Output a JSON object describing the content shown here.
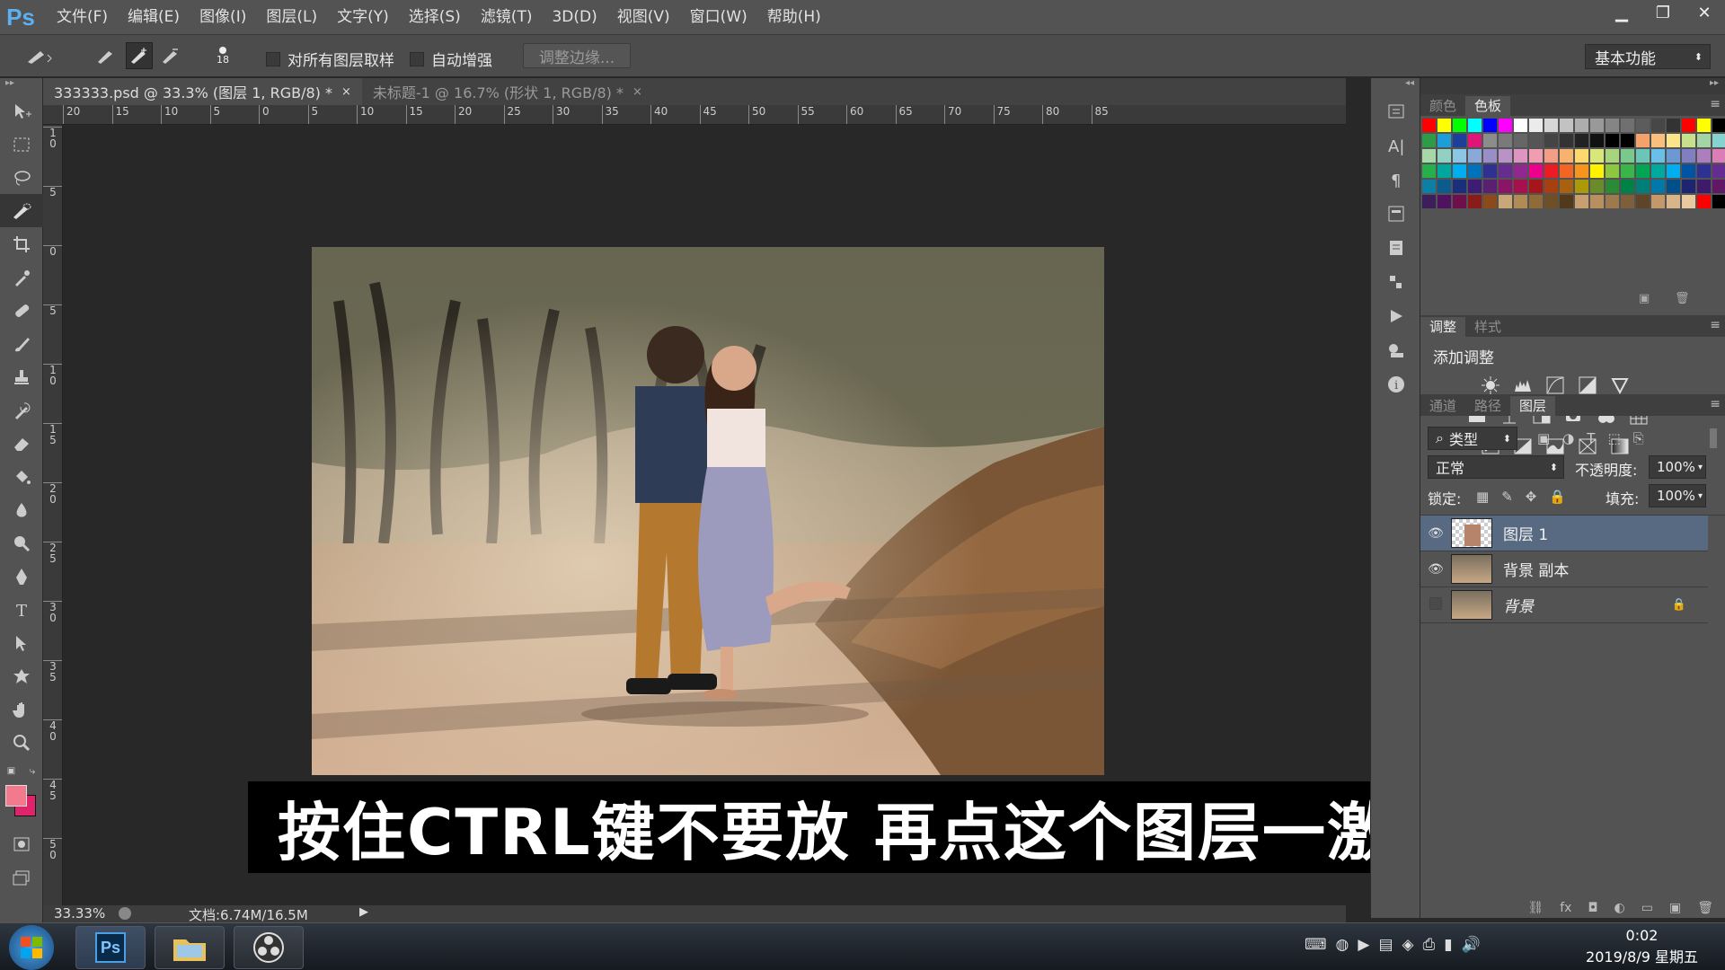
{
  "app": {
    "logo": "Ps"
  },
  "menu": [
    "文件(F)",
    "编辑(E)",
    "图像(I)",
    "图层(L)",
    "文字(Y)",
    "选择(S)",
    "滤镜(T)",
    "3D(D)",
    "视图(V)",
    "窗口(W)",
    "帮助(H)"
  ],
  "window_controls": {
    "minimize": "▁",
    "restore": "❐",
    "close": "✕"
  },
  "options": {
    "brush_size": "18",
    "sample_all_layers": "对所有图层取样",
    "auto_enhance": "自动增强",
    "refine_edge": "调整边缘...",
    "workspace": "基本功能"
  },
  "tabs": [
    {
      "label": "333333.psd @ 33.3% (图层 1, RGB/8) *",
      "close": "×"
    },
    {
      "label": "未标题-1 @ 16.7% (形状 1, RGB/8) *",
      "close": "×"
    }
  ],
  "ruler_h": [
    "20",
    "15",
    "10",
    "5",
    "0",
    "5",
    "10",
    "15",
    "20",
    "25",
    "30",
    "35",
    "40",
    "45",
    "50",
    "55",
    "60",
    "65",
    "70",
    "75",
    "80",
    "85"
  ],
  "ruler_v": [
    "1\n0",
    "5",
    "0",
    "5",
    "1\n0",
    "1\n5",
    "2\n0",
    "2\n5",
    "3\n0",
    "3\n5",
    "4\n0",
    "4\n5",
    "5\n0"
  ],
  "status": {
    "zoom": "33.33%",
    "doc": "文档:6.74M/16.5M"
  },
  "caption": "按住CTRL键不要放 再点这个图层一激活",
  "panels": {
    "color_tabs": [
      "颜色",
      "色板"
    ],
    "adjust_tabs": [
      "调整",
      "样式"
    ],
    "add_adjustment": "添加调整",
    "layer_tabs": [
      "通道",
      "路径",
      "图层"
    ],
    "filter_type": "类型",
    "blend_mode": "正常",
    "opacity_label": "不透明度:",
    "opacity_value": "100%",
    "lock_label": "锁定:",
    "fill_label": "填充:",
    "fill_value": "100%"
  },
  "layers": [
    {
      "name": "图层 1",
      "visible": true,
      "active": true
    },
    {
      "name": "背景 副本",
      "visible": true,
      "active": false
    },
    {
      "name": "背景",
      "visible": false,
      "active": false,
      "locked": true
    }
  ],
  "swatch_colors": [
    "#ff0000",
    "#ffff00",
    "#00ff00",
    "#00ffff",
    "#0000ff",
    "#ff00ff",
    "#ffffff",
    "#ebebeb",
    "#d6d6d6",
    "#c2c2c2",
    "#adadad",
    "#999999",
    "#858585",
    "#707070",
    "#5c5c5c",
    "#474747",
    "#333333",
    "#ff0000",
    "#ffff00",
    "#000000",
    "#2d9b48",
    "#1e9ed8",
    "#1d3f9a",
    "#e0157a",
    "#8c8c8c",
    "#7a7a7a",
    "#666666",
    "#555555",
    "#444444",
    "#333333",
    "#222222",
    "#111111",
    "#000000",
    "#000000",
    "#f5a26a",
    "#f9c07d",
    "#fbe48a",
    "#c6e08c",
    "#a2d4a5",
    "#86d2d0",
    "#a6d8a8",
    "#91d1c3",
    "#8bc7e5",
    "#8aa8d8",
    "#9a8ec9",
    "#b993c6",
    "#de95c1",
    "#f19db1",
    "#f29d86",
    "#f7b26e",
    "#fdd86d",
    "#d9e77a",
    "#a7d57d",
    "#7ac98c",
    "#6cc6b7",
    "#69c0e6",
    "#6c99d3",
    "#7f7fc2",
    "#ab7fbd",
    "#db7db6",
    "#26b04b",
    "#00a79d",
    "#00aeef",
    "#0072bc",
    "#2e3192",
    "#662d91",
    "#92278f",
    "#ec008c",
    "#ed1c24",
    "#f26522",
    "#f7941d",
    "#fff200",
    "#8dc63f",
    "#39b54a",
    "#00a651",
    "#00a99d",
    "#00aeef",
    "#0054a6",
    "#2e3192",
    "#662d91",
    "#0b7fa6",
    "#0b5b8c",
    "#1b2e79",
    "#3c1d73",
    "#5a1f6f",
    "#8a1466",
    "#a70f4d",
    "#a6151a",
    "#a73f0e",
    "#a86110",
    "#aa9a0a",
    "#6a8b29",
    "#2b8a35",
    "#008145",
    "#007f78",
    "#0079a8",
    "#004e8a",
    "#1e2570",
    "#3e1a6a",
    "#5f1766",
    "#3b1e5a",
    "#4e135c",
    "#6e0e4a",
    "#8b1a1a",
    "#8a4a1a",
    "#c9a878",
    "#b08b55",
    "#8f6b3a",
    "#6e4f28",
    "#52391a",
    "#c8a070",
    "#b89060",
    "#9c7a4e",
    "#7d5f3b",
    "#5f4528",
    "#c49868",
    "#d8b48a",
    "#e8c9a0",
    "#ff0000",
    "#000000"
  ]
}
